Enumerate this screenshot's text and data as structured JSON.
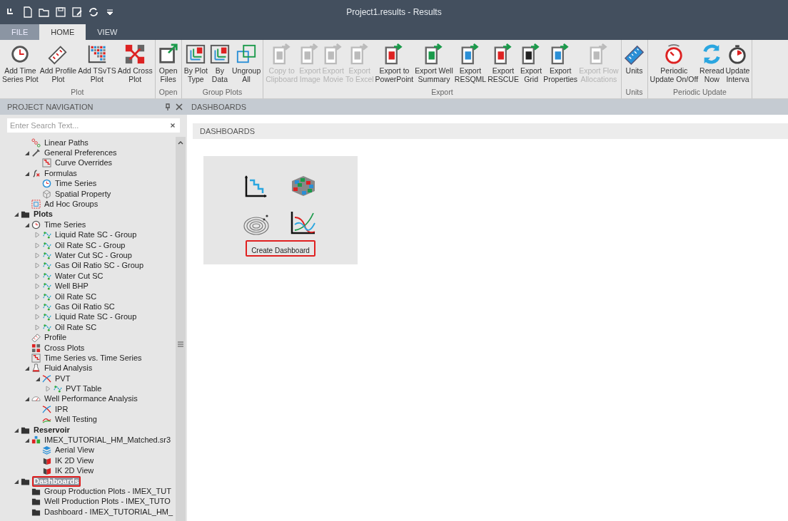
{
  "window": {
    "title": "Project1.results - Results"
  },
  "tabs": [
    {
      "label": "FILE",
      "selected": false,
      "kind": "file"
    },
    {
      "label": "HOME",
      "selected": true,
      "kind": "tab"
    },
    {
      "label": "VIEW",
      "selected": false,
      "kind": "tab"
    }
  ],
  "ribbon": {
    "groups": [
      {
        "label": "Plot",
        "buttons": [
          {
            "label": "Add Time\nSeries Plot",
            "kind": "clock",
            "disabled": false
          },
          {
            "label": "Add Profile\nPlot",
            "kind": "ruler",
            "disabled": false
          },
          {
            "label": "Add TSvTS\nPlot",
            "kind": "matrix",
            "disabled": false
          },
          {
            "label": "Add Cross\nPlot",
            "kind": "cross",
            "disabled": false
          }
        ]
      },
      {
        "label": "Open",
        "buttons": [
          {
            "label": "Open\nFiles",
            "kind": "open",
            "disabled": false
          }
        ]
      },
      {
        "label": "Group Plots",
        "buttons": [
          {
            "label": "By Plot\nType",
            "kind": "group",
            "disabled": false
          },
          {
            "label": "By\nData",
            "kind": "group",
            "disabled": false
          },
          {
            "label": "Ungroup\nAll",
            "kind": "ungroup",
            "disabled": false
          }
        ]
      },
      {
        "label": "Export",
        "buttons": [
          {
            "label": "Copy to\nClipboard",
            "kind": "export",
            "disabled": true
          },
          {
            "label": "Export\nImage",
            "kind": "export",
            "disabled": true
          },
          {
            "label": "Export\nMovie",
            "kind": "export",
            "disabled": true
          },
          {
            "label": "Export\nTo Excel",
            "kind": "export",
            "disabled": true
          },
          {
            "label": "Export to\nPowerPoint",
            "kind": "export",
            "disabled": false
          },
          {
            "label": "Export Well\nSummary",
            "kind": "export",
            "disabled": false
          },
          {
            "label": "Export\nRESQML",
            "kind": "export",
            "disabled": false
          },
          {
            "label": "Export\nRESCUE",
            "kind": "export",
            "disabled": false
          },
          {
            "label": "Export\nGrid",
            "kind": "export",
            "disabled": false
          },
          {
            "label": "Export\nProperties",
            "kind": "export",
            "disabled": false
          },
          {
            "label": "Export Flow\nAllocations",
            "kind": "export",
            "disabled": true
          }
        ]
      },
      {
        "label": "Units",
        "buttons": [
          {
            "label": "Units",
            "kind": "units",
            "disabled": false
          }
        ]
      },
      {
        "label": "Periodic Update",
        "buttons": [
          {
            "label": "Periodic\nUpdate On/Off",
            "kind": "timer",
            "disabled": false
          },
          {
            "label": "Reread\nNow",
            "kind": "reread",
            "disabled": false
          },
          {
            "label": "Update\nInterva",
            "kind": "stopwatch",
            "disabled": false
          }
        ]
      }
    ]
  },
  "navigation": {
    "title": "PROJECT NAVIGATION",
    "search": {
      "placeholder": "Enter Search Text..."
    }
  },
  "tree": {
    "continued": [
      {
        "label": "Linear Paths",
        "kind": "links",
        "selected": false,
        "highlighted": false
      },
      {
        "label": "General Preferences",
        "kind": "wrench",
        "selected": false,
        "highlighted": false,
        "expanded": true,
        "children": [
          {
            "label": "Curve Overrides",
            "kind": "step",
            "selected": false,
            "highlighted": false
          }
        ]
      },
      {
        "label": "Formulas",
        "kind": "formula",
        "selected": false,
        "highlighted": false,
        "expanded": true,
        "children": [
          {
            "label": "Time Series",
            "kind": "clock-blue",
            "selected": false,
            "highlighted": false
          },
          {
            "label": "Spatial Property",
            "kind": "cube",
            "selected": false,
            "highlighted": false
          }
        ]
      },
      {
        "label": "Ad Hoc Groups",
        "kind": "group",
        "selected": false,
        "highlighted": false
      }
    ],
    "nodes": [
      {
        "label": "Plots",
        "kind": "folder",
        "selected": false,
        "highlighted": false,
        "expanded": true,
        "children": [
          {
            "label": "Time Series",
            "kind": "clock",
            "selected": false,
            "highlighted": false,
            "expanded": true,
            "children": [
              {
                "label": "Liquid Rate SC - Group",
                "kind": "curve",
                "selected": false,
                "highlighted": false,
                "expanded": false
              },
              {
                "label": "Oil Rate SC - Group",
                "kind": "curve",
                "selected": false,
                "highlighted": false,
                "expanded": false
              },
              {
                "label": "Water Cut SC - Group",
                "kind": "curve",
                "selected": false,
                "highlighted": false,
                "expanded": false
              },
              {
                "label": "Gas Oil Ratio SC - Group",
                "kind": "curve",
                "selected": false,
                "highlighted": false,
                "expanded": false
              },
              {
                "label": "Water Cut SC",
                "kind": "curve",
                "selected": false,
                "highlighted": false,
                "expanded": false
              },
              {
                "label": "Well BHP",
                "kind": "curve",
                "selected": false,
                "highlighted": false,
                "expanded": false
              },
              {
                "label": "Oil Rate SC",
                "kind": "curve",
                "selected": false,
                "highlighted": false,
                "expanded": false
              },
              {
                "label": "Gas Oil Ratio SC",
                "kind": "curve",
                "selected": false,
                "highlighted": false,
                "expanded": false
              },
              {
                "label": "Liquid Rate SC - Group",
                "kind": "curve",
                "selected": false,
                "highlighted": false,
                "expanded": false
              },
              {
                "label": "Oil Rate SC",
                "kind": "curve",
                "selected": false,
                "highlighted": false,
                "expanded": false
              }
            ]
          },
          {
            "label": "Profile",
            "kind": "ruler",
            "selected": false,
            "highlighted": false
          },
          {
            "label": "Cross Plots",
            "kind": "cross",
            "selected": false,
            "highlighted": false
          },
          {
            "label": "Time Series vs. Time Series",
            "kind": "step",
            "selected": false,
            "highlighted": false
          },
          {
            "label": "Fluid Analysis",
            "kind": "flask",
            "selected": false,
            "highlighted": false,
            "expanded": true,
            "children": [
              {
                "label": "PVT",
                "kind": "pvt",
                "selected": false,
                "highlighted": false,
                "expanded": true,
                "children": [
                  {
                    "label": "PVT Table",
                    "kind": "curve",
                    "selected": false,
                    "highlighted": false,
                    "expanded": false
                  }
                ]
              }
            ]
          },
          {
            "label": "Well Performance Analysis",
            "kind": "gauge",
            "selected": false,
            "highlighted": false,
            "expanded": true,
            "children": [
              {
                "label": "IPR",
                "kind": "pvt",
                "selected": false,
                "highlighted": false
              },
              {
                "label": "Well Testing",
                "kind": "line",
                "selected": false,
                "highlighted": false
              }
            ]
          }
        ]
      },
      {
        "label": "Reservoir",
        "kind": "folder",
        "selected": false,
        "highlighted": false,
        "expanded": true,
        "children": [
          {
            "label": "IMEX_TUTORIAL_HM_Matched.sr3",
            "kind": "model",
            "selected": false,
            "highlighted": false,
            "expanded": true,
            "children": [
              {
                "label": "Aerial View",
                "kind": "layers",
                "selected": false,
                "highlighted": false
              },
              {
                "label": "IK 2D View",
                "kind": "view",
                "selected": false,
                "highlighted": false
              },
              {
                "label": "IK 2D View",
                "kind": "view",
                "selected": false,
                "highlighted": false
              }
            ]
          }
        ]
      },
      {
        "label": "Dashboards",
        "kind": "folder",
        "selected": true,
        "highlighted": true,
        "expanded": true,
        "children": [
          {
            "label": "Group Production Plots - IMEX_TUT",
            "kind": "folder",
            "selected": false,
            "highlighted": false
          },
          {
            "label": "Well Production Plots - IMEX_TUTO",
            "kind": "folder",
            "selected": false,
            "highlighted": false
          },
          {
            "label": "Dashboard - IMEX_TUTORIAL_HM_",
            "kind": "folder",
            "selected": false,
            "highlighted": false
          }
        ]
      }
    ]
  },
  "document_tab": {
    "title": "DASHBOARDS"
  },
  "dashboards": {
    "heading": "DASHBOARDS",
    "create_button": {
      "label": "Create Dashboard",
      "highlighted": true
    }
  }
}
